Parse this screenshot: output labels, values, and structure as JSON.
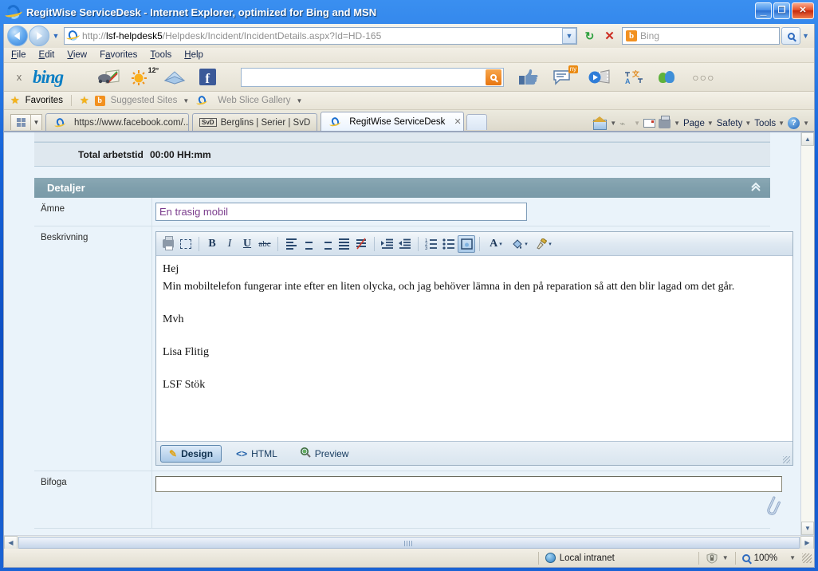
{
  "window": {
    "title": "RegitWise ServiceDesk - Internet Explorer, optimized for Bing and MSN",
    "minimize_label": "_",
    "maximize_label": "❐",
    "close_label": "✕"
  },
  "navbar": {
    "url_host": "lsf-helpdesk5",
    "url_prefix": "http://",
    "url_path": "/Helpdesk/Incident/IncidentDetails.aspx?Id=HD-165",
    "dropdown_caret": "▼",
    "refresh_label": "↻",
    "stop_label": "✕",
    "search_provider": "Bing",
    "search_value": "",
    "bing_mark": "b",
    "search_dropdown": "▼"
  },
  "menubar": {
    "items": [
      "File",
      "Edit",
      "View",
      "Favorites",
      "Tools",
      "Help"
    ]
  },
  "bingbar": {
    "close_label": "x",
    "brand": "bing",
    "weather_temp": "12°",
    "search_value": "",
    "chat_badge": "ny",
    "overflow_label": "○○○",
    "icons": [
      "traffic-map-icon",
      "weather-sun-icon",
      "mail-envelope-icon",
      "facebook-icon"
    ],
    "right_icons": [
      "thumbs-up-icon",
      "chat-bubble-icon",
      "video-film-icon",
      "translate-icon",
      "messenger-icon"
    ]
  },
  "favbar": {
    "favorites_label": "Favorites",
    "suggested_sites_label": "Suggested Sites",
    "web_slice_label": "Web Slice Gallery",
    "caret": "▼"
  },
  "tabbar": {
    "quick_tabs_label": "",
    "tabs": [
      {
        "label": "https://www.facebook.com/...",
        "active": false,
        "icon": "ie-icon"
      },
      {
        "label": "Berglins | Serier | SvD",
        "active": false,
        "icon": "svd-icon"
      },
      {
        "label": "RegitWise ServiceDesk",
        "active": true,
        "icon": "ie-icon",
        "close": "✕"
      }
    ],
    "commands": [
      {
        "label": "Page",
        "caret": "▼"
      },
      {
        "label": "Safety",
        "caret": "▼"
      },
      {
        "label": "Tools",
        "caret": "▼"
      }
    ],
    "overflow": "»"
  },
  "page": {
    "summary_row": {
      "label": "Total arbetstid",
      "value": "00:00 HH:mm"
    },
    "details_section": {
      "title": "Detaljer",
      "collapse_icon": "«"
    },
    "subject": {
      "label": "Ämne",
      "value": "En trasig mobil "
    },
    "description": {
      "label": "Beskrivning",
      "lines": [
        "Hej",
        "Min mobiltelefon fungerar inte efter en liten olycka, och jag behöver lämna in den på reparation så att den blir lagad om det går.",
        "",
        "Mvh",
        "",
        "Lisa Flitig",
        "",
        "LSF Stök"
      ]
    },
    "editor_toolbar": {
      "buttons": [
        "print-icon",
        "select-all-icon",
        "bold-icon",
        "italic-icon",
        "underline-icon",
        "strikethrough-icon",
        "align-left-icon",
        "align-center-icon",
        "align-right-icon",
        "align-justify-icon",
        "remove-format-icon",
        "indent-increase-icon",
        "indent-decrease-icon",
        "ordered-list-icon",
        "unordered-list-icon",
        "insert-box-icon",
        "font-color-icon",
        "background-color-icon",
        "format-painter-icon"
      ],
      "bold_label": "B",
      "italic_label": "I",
      "underline_label": "U",
      "strike_label": "abc",
      "fontcolor_label": "A",
      "caret": "▾"
    },
    "editor_tabs": [
      {
        "label": "Design",
        "active": true,
        "icon": "pencil-icon"
      },
      {
        "label": "HTML",
        "active": false,
        "icon": "code-icon"
      },
      {
        "label": "Preview",
        "active": false,
        "icon": "magnifier-icon"
      }
    ],
    "attachment": {
      "label": "Bifoga",
      "value": "",
      "clip_icon": "paperclip-icon"
    }
  },
  "statusbar": {
    "zone": "Local intranet",
    "zone_icon": "globe-icon",
    "protected_icon": "shield-icon",
    "zoom": "100%",
    "caret": "▼"
  }
}
